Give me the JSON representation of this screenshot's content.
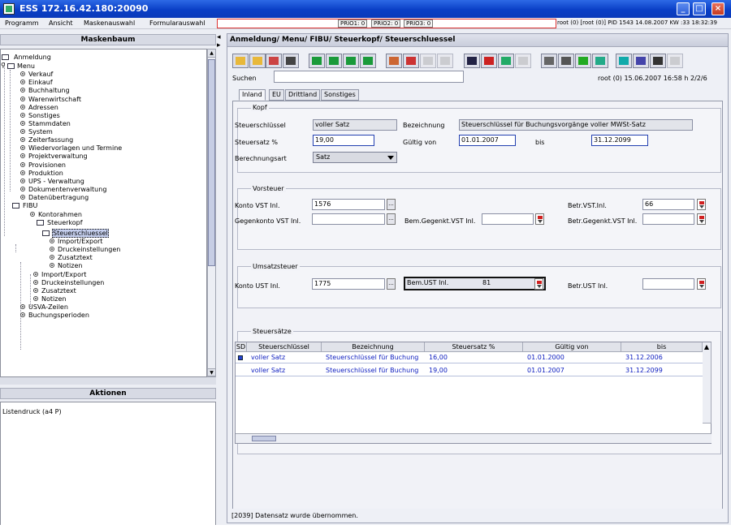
{
  "window": {
    "title": "ESS 172.16.42.180:20090"
  },
  "menu": {
    "items": [
      "Programm",
      "Ansicht",
      "Maskenauswahl",
      "Formularauswahl"
    ],
    "prio": [
      "PRIO1: 0",
      "PRIO2: 0",
      "PRIO3: 0"
    ],
    "status": "root (0) [root (0)] PID 1543 14.08.2007 KW :33 18:32:39"
  },
  "left": {
    "tree_title": "Maskenbaum",
    "actions_title": "Aktionen",
    "actions": [
      "Listendruck (a4 P)"
    ],
    "tree": [
      "Anmeldung",
      "Menu",
      "Verkauf",
      "Einkauf",
      "Buchhaltung",
      "Warenwirtschaft",
      "Adressen",
      "Sonstiges",
      "Stammdaten",
      "System",
      "Zeiterfassung",
      "Wiedervorlagen und Termine",
      "Projektverwaltung",
      "Provisionen",
      "Produktion",
      "UPS - Verwaltung",
      "Dokumentenverwaltung",
      "Datenübertragung",
      "FIBU",
      "Kontorahmen",
      "Steuerkopf",
      "Steuerschluessel",
      "Import/Export",
      "Druckeinstellungen",
      "Zusatztext",
      "Notizen",
      "Import/Export",
      "Druckeinstellungen",
      "Zusatztext",
      "Notizen",
      "USVA-Zeilen",
      "Buchungsperioden"
    ]
  },
  "main": {
    "breadcrumb": "Anmeldung/ Menu/ FIBU/ Steuerkopf/ Steuerschluessel",
    "search_label": "Suchen",
    "search_value": "",
    "root_info": "root (0)  15.06.2007 16:58 h 2/2/6",
    "tabs": [
      "Inland",
      "EU",
      "Drittland",
      "Sonstiges"
    ],
    "kopf": {
      "title": "Kopf",
      "steuerschluessel_label": "Steuerschlüssel",
      "steuerschluessel_value": "voller Satz",
      "bezeichnung_label": "Bezeichnung",
      "bezeichnung_value": "Steuerschlüssel für Buchungsvorgänge voller MWSt-Satz",
      "steuersatz_label": "Steuersatz %",
      "steuersatz_value": "19,00",
      "gueltig_label": "Gültig von",
      "gueltig_value": "01.01.2007",
      "bis_label": "bis",
      "bis_value": "31.12.2099",
      "berechnung_label": "Berechnungsart",
      "berechnung_value": "Satz"
    },
    "vorsteuer": {
      "title": "Vorsteuer",
      "konto_label": "Konto VST Inl.",
      "konto_value": "1576",
      "gegenkonto_label": "Gegenkonto VST Inl.",
      "gegenkonto_value": "",
      "bem_label": "Bem.Gegenkt.VST Inl.",
      "bem_value": "",
      "betr_label": "Betr.VST.Inl.",
      "betr_value": "66",
      "betrg_label": "Betr.Gegenkt.VST Inl.",
      "betrg_value": ""
    },
    "ust": {
      "title": "Umsatzsteuer",
      "konto_label": "Konto UST Inl.",
      "konto_value": "1775",
      "bem_label": "Bem.UST Inl.",
      "bem_value": "81",
      "betr_label": "Betr.UST Inl.",
      "betr_value": ""
    },
    "saetze": {
      "title": "Steuersätze",
      "columns": [
        "SD",
        "Steuerschlüssel",
        "Bezeichnung",
        "Steuersatz %",
        "Gültig von",
        "bis"
      ],
      "rows": [
        [
          "voller Satz",
          "Steuerschlüssel für Buchung",
          "16,00",
          "01.01.2000",
          "31.12.2006"
        ],
        [
          "voller Satz",
          "Steuerschlüssel für Buchung",
          "19,00",
          "01.01.2007",
          "31.12.2099"
        ]
      ]
    },
    "status": "[2039] Datensatz wurde übernommen."
  }
}
